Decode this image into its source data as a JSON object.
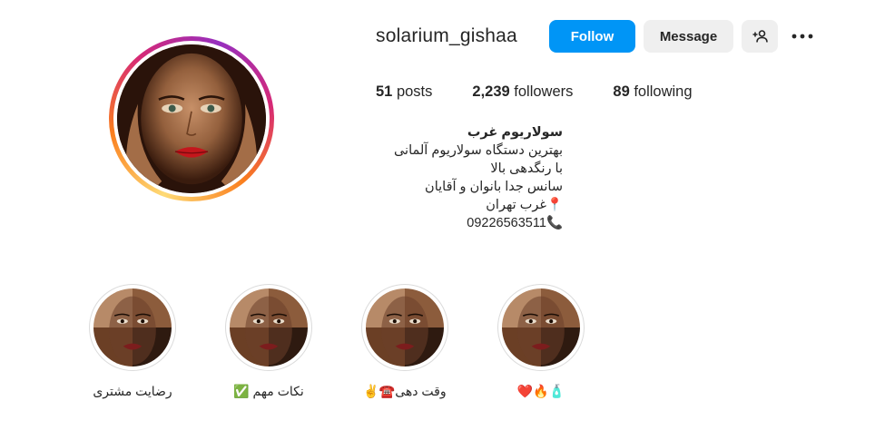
{
  "profile": {
    "username": "solarium_gishaa",
    "follow_label": "Follow",
    "message_label": "Message",
    "add_user_icon": "add-user-icon",
    "more_icon": "more-horizontal-icon"
  },
  "stats": {
    "posts_count": "51",
    "posts_label": " posts",
    "followers_count": "2,239",
    "followers_label": " followers",
    "following_count": "89",
    "following_label": " following"
  },
  "bio": {
    "name": "سولاریوم غرب",
    "lines": [
      "بهترین دستگاه سولاریوم آلمانی",
      "با رنگدهی بالا",
      "سانس جدا بانوان و آقایان",
      "📍غرب تهران",
      "📞09226563511"
    ]
  },
  "highlights": [
    {
      "label": "رضایت مشتری"
    },
    {
      "label": "نکات مهم ✅"
    },
    {
      "label": "وقت دهی☎️✌️"
    },
    {
      "label": "🧴🔥❤️"
    }
  ],
  "colors": {
    "follow_button": "#0095f6",
    "secondary_button": "#efefef",
    "text": "#262626"
  }
}
